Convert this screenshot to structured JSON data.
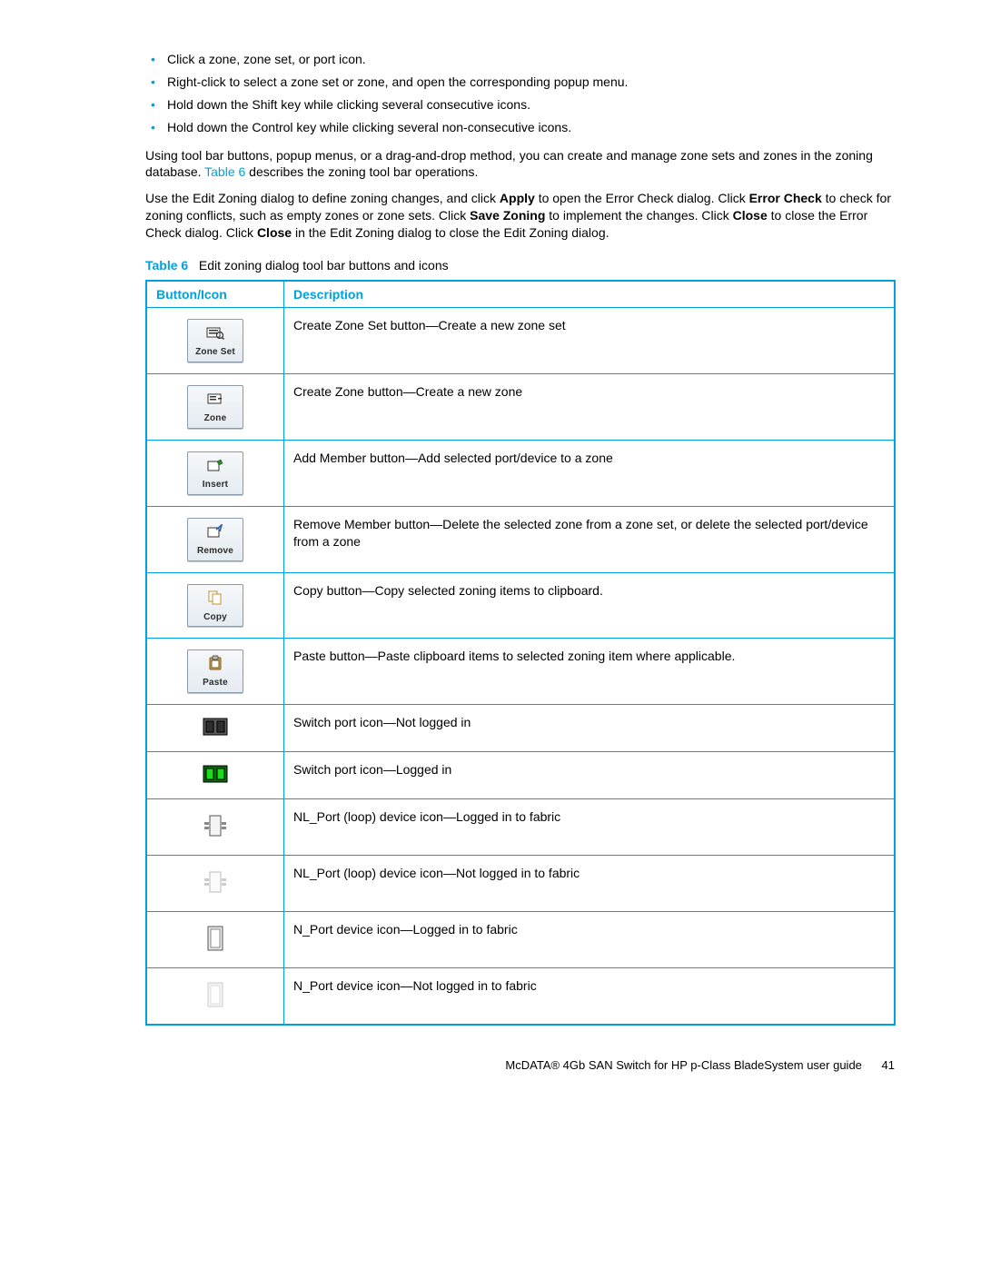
{
  "bullets": [
    "Click a zone, zone set, or port icon.",
    "Right-click to select a zone set or zone, and open the corresponding popup menu.",
    "Hold down the Shift key while clicking several consecutive icons.",
    "Hold down the Control key while clicking several non-consecutive icons."
  ],
  "para1_a": "Using tool bar buttons, popup menus, or a drag-and-drop method, you can create and manage zone sets and zones in the zoning database. ",
  "para1_link": "Table 6",
  "para1_b": " describes the zoning tool bar operations.",
  "para2_a": "Use the Edit Zoning dialog to define zoning changes, and click ",
  "para2_apply": "Apply",
  "para2_b": " to open the Error Check dialog. Click ",
  "para2_errorcheck": "Error Check",
  "para2_c": " to check for zoning conflicts, such as empty zones or zone sets. Click ",
  "para2_savezoning": "Save Zoning",
  "para2_d": " to implement the changes. Click ",
  "para2_close1": "Close",
  "para2_e": " to close the Error Check dialog. Click ",
  "para2_close2": "Close",
  "para2_f": " in the Edit Zoning dialog to close the Edit Zoning dialog.",
  "caption_label": "Table 6",
  "caption_text": "Edit zoning dialog tool bar buttons and icons",
  "table": {
    "h1": "Button/Icon",
    "h2": "Description",
    "rows": [
      {
        "btnlabel": "Zone Set",
        "desc": "Create Zone Set button—Create a new zone set"
      },
      {
        "btnlabel": "Zone",
        "desc": "Create Zone button—Create a new zone"
      },
      {
        "btnlabel": "Insert",
        "desc": "Add Member button—Add selected port/device to a zone"
      },
      {
        "btnlabel": "Remove",
        "desc": "Remove Member button—Delete the selected zone from a zone set, or delete the selected port/device from a zone"
      },
      {
        "btnlabel": "Copy",
        "desc": "Copy button—Copy selected zoning items to clipboard."
      },
      {
        "btnlabel": "Paste",
        "desc": "Paste button—Paste clipboard items to selected zoning item where applicable."
      },
      {
        "btnlabel": "",
        "desc": "Switch port icon—Not logged in"
      },
      {
        "btnlabel": "",
        "desc": "Switch port icon—Logged in"
      },
      {
        "btnlabel": "",
        "desc": "NL_Port (loop) device icon—Logged in to fabric"
      },
      {
        "btnlabel": "",
        "desc": "NL_Port (loop) device icon—Not logged in to fabric"
      },
      {
        "btnlabel": "",
        "desc": "N_Port device icon—Logged in to fabric"
      },
      {
        "btnlabel": "",
        "desc": "N_Port device icon—Not logged in to fabric"
      }
    ]
  },
  "footer_text": "McDATA® 4Gb SAN Switch for HP p-Class BladeSystem user guide",
  "footer_page": "41"
}
